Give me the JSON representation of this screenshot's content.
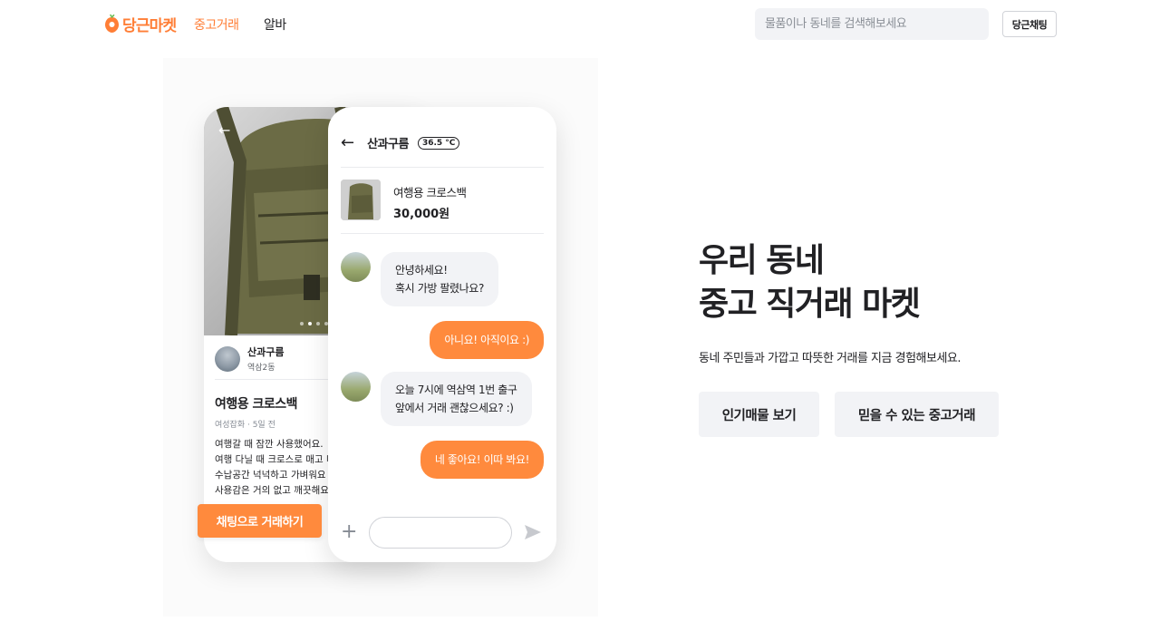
{
  "header": {
    "logo_text": "당근마켓",
    "nav": [
      {
        "label": "중고거래",
        "active": true
      },
      {
        "label": "알바",
        "active": false
      }
    ],
    "search_placeholder": "물품이나 동네를 검색해보세요",
    "chat_button": "당근채팅"
  },
  "product_phone": {
    "seller_name": "산과구름",
    "seller_location": "역삼2동",
    "item_title": "여행용 크로스백",
    "item_meta": "여성잡화 · 5일 전",
    "description_lines": [
      "여행갈 때 잠깐 사용했어요.",
      "여행 다닐 때 크로스로 매고 다",
      "수납공간 넉넉하고 가벼워요",
      "사용감은 거의 없고 깨끗해요"
    ],
    "cta_label": "채팅으로 거래하기"
  },
  "chat_phone": {
    "partner_name": "산과구름",
    "temperature": "36.5 °C",
    "product_name": "여행용 크로스백",
    "product_price": "30,000원",
    "messages": [
      {
        "from": "them",
        "lines": [
          "안녕하세요!",
          "혹시 가방 팔렸나요?"
        ]
      },
      {
        "from": "me",
        "lines": [
          "아니요! 아직이요 :)"
        ]
      },
      {
        "from": "them",
        "lines": [
          "오늘 7시에 역삼역 1번 출구",
          "앞에서 거래 괜찮으세요? :)"
        ]
      },
      {
        "from": "me",
        "lines": [
          "네 좋아요! 이따 봐요!"
        ]
      }
    ]
  },
  "hero": {
    "title_lines": [
      "우리 동네",
      "중고 직거래 마켓"
    ],
    "subtitle": "동네 주민들과 가깝고 따뜻한 거래를 지금 경험해보세요.",
    "buttons": [
      "인기매물 보기",
      "믿을 수 있는 중고거래"
    ]
  },
  "colors": {
    "brand": "#ff7e36",
    "bubble_out": "#ff8a3d",
    "bubble_in": "#f2f3f6"
  }
}
